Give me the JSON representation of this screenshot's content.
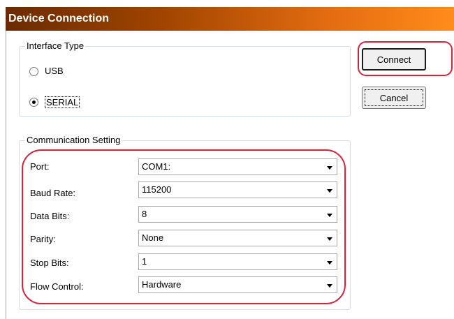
{
  "window": {
    "title": "Device Connection"
  },
  "interface_type": {
    "label": "Interface Type",
    "options": [
      {
        "label": "USB",
        "checked": false
      },
      {
        "label": "SERIAL",
        "checked": true
      }
    ]
  },
  "buttons": {
    "connect": "Connect",
    "cancel": "Cancel"
  },
  "communication": {
    "label": "Communication Setting",
    "settings": [
      {
        "label": "Port:",
        "value": "COM1:"
      },
      {
        "label": "Baud Rate:",
        "value": "115200"
      },
      {
        "label": "Data Bits:",
        "value": "8"
      },
      {
        "label": "Parity:",
        "value": "None"
      },
      {
        "label": "Stop Bits:",
        "value": "1"
      },
      {
        "label": "Flow Control:",
        "value": "Hardware"
      }
    ]
  },
  "colors": {
    "highlight": "#d9233b",
    "title_start": "#6b2a00",
    "title_end": "#ff8c1a"
  }
}
